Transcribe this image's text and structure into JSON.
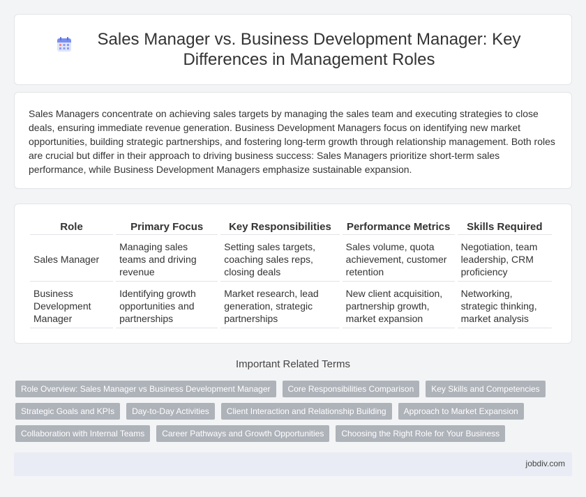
{
  "header": {
    "title": "Sales Manager vs. Business Development Manager: Key Differences in Management Roles",
    "icon": "calendar-icon"
  },
  "intro": {
    "text": "Sales Managers concentrate on achieving sales targets by managing the sales team and executing strategies to close deals, ensuring immediate revenue generation. Business Development Managers focus on identifying new market opportunities, building strategic partnerships, and fostering long-term growth through relationship management. Both roles are crucial but differ in their approach to driving business success: Sales Managers prioritize short-term sales performance, while Business Development Managers emphasize sustainable expansion."
  },
  "table": {
    "headers": [
      "Role",
      "Primary Focus",
      "Key Responsibilities",
      "Performance Metrics",
      "Skills Required"
    ],
    "rows": [
      [
        "Sales Manager",
        "Managing sales teams and driving revenue",
        "Setting sales targets, coaching sales reps, closing deals",
        "Sales volume, quota achievement, customer retention",
        "Negotiation, team leadership, CRM proficiency"
      ],
      [
        "Business Development Manager",
        "Identifying growth opportunities and partnerships",
        "Market research, lead generation, strategic partnerships",
        "New client acquisition, partnership growth, market expansion",
        "Networking, strategic thinking, market analysis"
      ]
    ]
  },
  "related": {
    "title": "Important Related Terms",
    "rows": [
      [
        "Role Overview: Sales Manager vs Business Development Manager",
        "Core Responsibilities Comparison",
        "Key Skills and Competencies"
      ],
      [
        "Strategic Goals and KPIs",
        "Day-to-Day Activities",
        "Client Interaction and Relationship Building",
        "Approach to Market Expansion"
      ],
      [
        "Collaboration with Internal Teams",
        "Career Pathways and Growth Opportunities",
        "Choosing the Right Role for Your Business"
      ]
    ]
  },
  "footer": {
    "site": "jobdiv.com"
  },
  "colors": {
    "tag_bg": "#aeb2b9",
    "footer_bg": "#e9ecf4",
    "icon_accent": "#7b8ff0"
  }
}
